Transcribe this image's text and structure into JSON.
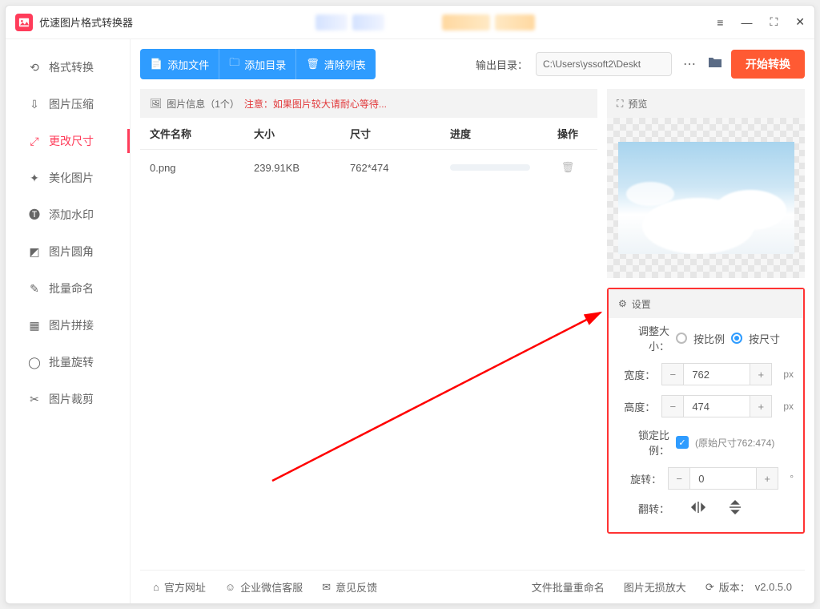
{
  "app": {
    "title": "优速图片格式转换器"
  },
  "titlebar": {
    "menu": "≡",
    "min": "—",
    "full": "⛶",
    "close": "✕"
  },
  "sidebar": {
    "items": [
      {
        "label": "格式转换"
      },
      {
        "label": "图片压缩"
      },
      {
        "label": "更改尺寸"
      },
      {
        "label": "美化图片"
      },
      {
        "label": "添加水印"
      },
      {
        "label": "图片圆角"
      },
      {
        "label": "批量命名"
      },
      {
        "label": "图片拼接"
      },
      {
        "label": "批量旋转"
      },
      {
        "label": "图片裁剪"
      }
    ]
  },
  "toolbar": {
    "add_file": "添加文件",
    "add_folder": "添加目录",
    "clear": "清除列表",
    "out_label": "输出目录：",
    "out_path": "C:\\Users\\yssoft2\\Deskt",
    "start": "开始转换"
  },
  "info": {
    "prefix": "图片信息（1个）",
    "warn": "注意：如果图片较大请耐心等待..."
  },
  "table": {
    "headers": {
      "name": "文件名称",
      "size": "大小",
      "dim": "尺寸",
      "prog": "进度",
      "op": "操作"
    },
    "rows": [
      {
        "name": "0.png",
        "size": "239.91KB",
        "dim": "762*474"
      }
    ]
  },
  "preview": {
    "title": "预览"
  },
  "settings": {
    "title": "设置",
    "resize_label": "调整大小：",
    "opt_ratio": "按比例",
    "opt_size": "按尺寸",
    "width_label": "宽度：",
    "width_val": "762",
    "height_label": "高度：",
    "height_val": "474",
    "px": "px",
    "lock_label": "锁定比例：",
    "orig": "(原始尺寸762:474)",
    "rotate_label": "旋转：",
    "rotate_val": "0",
    "deg": "°",
    "flip_label": "翻转："
  },
  "footer": {
    "site": "官方网址",
    "support": "企业微信客服",
    "feedback": "意见反馈",
    "rename": "文件批量重命名",
    "lossless": "图片无损放大",
    "version_label": "版本：",
    "version": "v2.0.5.0"
  }
}
